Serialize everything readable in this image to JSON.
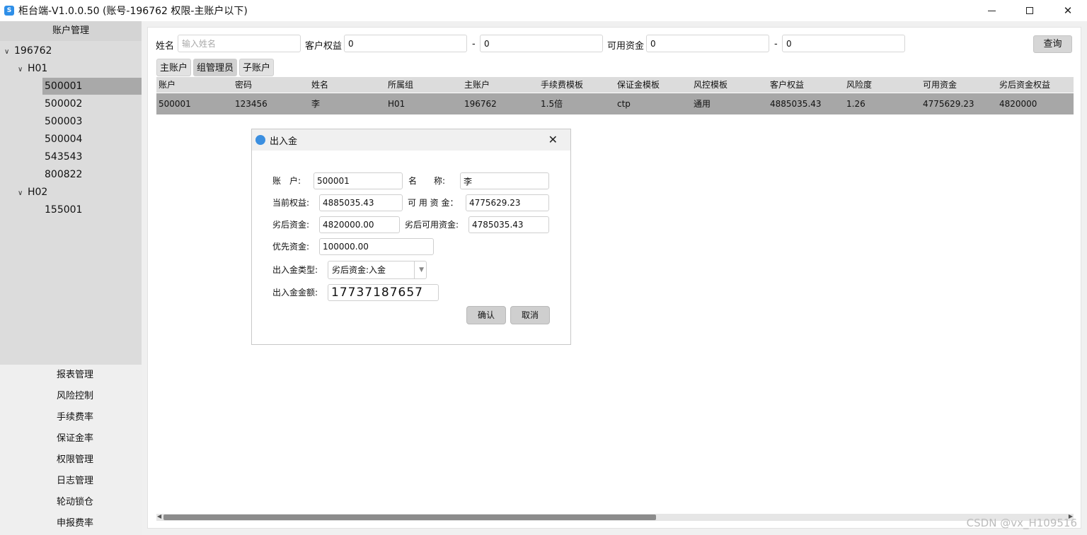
{
  "window": {
    "title": "柜台端-V1.0.0.50 (账号-196762 权限-主账户以下)",
    "icon_glyph": "S",
    "icon": "app-logo-icon"
  },
  "sidebar": {
    "header": "账户管理",
    "tree": {
      "root": "196762",
      "groups": [
        {
          "name": "H01",
          "accounts": [
            "500001",
            "500002",
            "500003",
            "500004",
            "543543",
            "800822"
          ]
        },
        {
          "name": "H02",
          "accounts": [
            "155001"
          ]
        }
      ]
    },
    "bottom_menu": [
      "报表管理",
      "风险控制",
      "手续费率",
      "保证金率",
      "权限管理",
      "日志管理",
      "轮动锁仓",
      "申报费率"
    ]
  },
  "filter": {
    "name_label": "姓名",
    "name_placeholder": "输入姓名",
    "equity_label": "客户权益",
    "equity_from": "0",
    "equity_to": "0",
    "funds_label": "可用资金",
    "funds_from": "0",
    "funds_to": "0",
    "dash": "-",
    "query_button": "查询"
  },
  "tabs": [
    "主账户",
    "组管理员",
    "子账户"
  ],
  "table": {
    "columns": [
      "账户",
      "密码",
      "姓名",
      "所属组",
      "主账户",
      "手续费模板",
      "保证金模板",
      "风控模板",
      "客户权益",
      "风险度",
      "可用资金",
      "劣后资金权益"
    ],
    "rows": [
      [
        "500001",
        "123456",
        "李",
        "H01",
        "196762",
        "1.5倍",
        "ctp",
        "通用",
        "4885035.43",
        "1.26",
        "4775629.23",
        "4820000"
      ]
    ]
  },
  "dialog": {
    "title": "出入金",
    "account_label": "账　户:",
    "account_value": "500001",
    "name_label": "名　　称:",
    "name_value": "李",
    "equity_label": "当前权益:",
    "equity_value": "4885035.43",
    "available_label": "可 用 资 金：",
    "available_value": "4775629.23",
    "sub_funds_label": "劣后资金:",
    "sub_funds_value": "4820000.00",
    "sub_available_label": "劣后可用资金:",
    "sub_available_value": "4785035.43",
    "priority_label": "优先资金:",
    "priority_value": "100000.00",
    "type_label": "出入金类型:",
    "type_value": "劣后资金:入金",
    "amount_label": "出入金金额:",
    "amount_value": "17737187657",
    "confirm_button": "确认",
    "cancel_button": "取消"
  },
  "watermark": "CSDN @vx_H109516",
  "colors": {
    "selected_row": "#a7a7a7",
    "header_bg": "#dcdcdc",
    "app_icon": "#2f8fe8"
  }
}
